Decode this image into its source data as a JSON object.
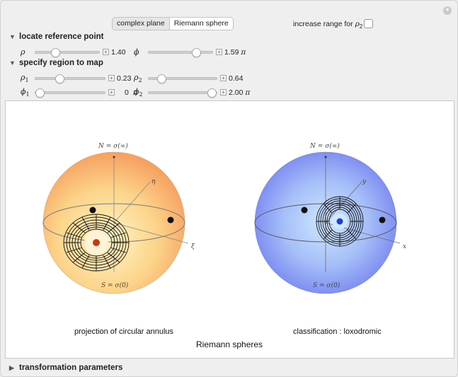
{
  "view_toggle": {
    "options": [
      "complex plane",
      "Riemann sphere"
    ],
    "selected": "Riemann sphere"
  },
  "range_checkbox": {
    "label": "increase range for",
    "symbol": "ρ",
    "sub": "2",
    "checked": false
  },
  "sections": {
    "reference": "locate reference point",
    "region": "specify region to map",
    "transform": "transformation parameters"
  },
  "controls": {
    "rho": {
      "symbol": "ρ",
      "sub": "",
      "value": "1.40",
      "unit": "",
      "level": 0.28
    },
    "phi": {
      "symbol": "ϕ",
      "sub": "",
      "value": "1.59",
      "unit": "π",
      "level": 0.79
    },
    "rho1": {
      "symbol": "ρ",
      "sub": "1",
      "value": "0.23",
      "unit": "",
      "level": 0.33
    },
    "rho2": {
      "symbol": "ρ",
      "sub": "2",
      "value": "0.64",
      "unit": "",
      "level": 0.15
    },
    "phi1": {
      "symbol": "ϕ",
      "sub": "1",
      "value": "0",
      "unit": "π",
      "level": 0.0
    },
    "phi2": {
      "symbol": "ϕ",
      "sub": "2",
      "value": "2.00",
      "unit": "π",
      "level": 1.0
    }
  },
  "plot": {
    "left": {
      "top_label": "N = σ(∞)",
      "bottom_label": "S = σ(0)",
      "axis1": "η",
      "axis2": "ξ",
      "caption": "projection of circular annulus"
    },
    "right": {
      "top_label": "N = σ(∞)",
      "bottom_label": "S = σ(0)",
      "axis1": "y",
      "axis2": "x",
      "caption": "classification : loxodromic"
    },
    "title": "Riemann spheres",
    "colors": {
      "left_sphere": "#f9b46a",
      "right_sphere": "#7f93f2",
      "left_center": "#c33a12",
      "right_center": "#1d3fd8"
    }
  }
}
